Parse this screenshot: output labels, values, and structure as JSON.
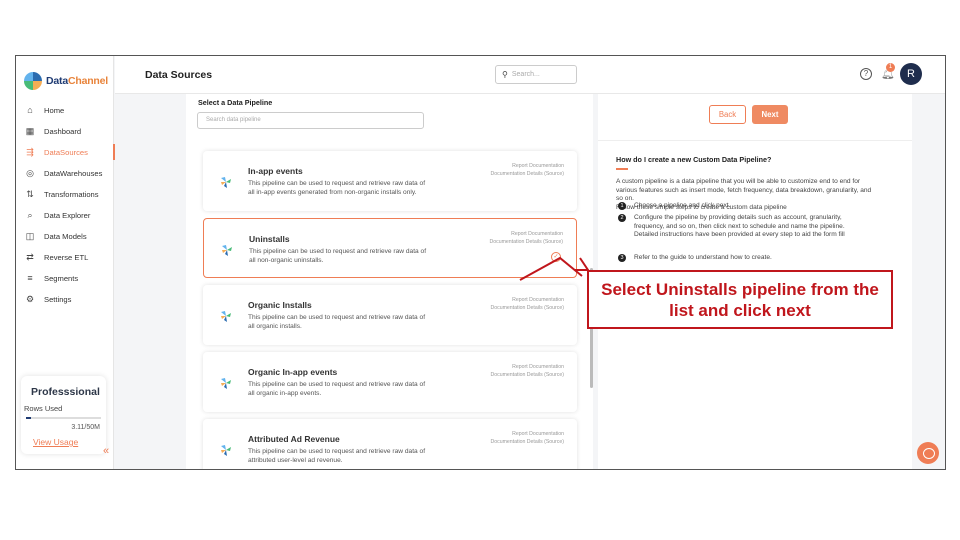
{
  "brand": {
    "part1": "Data",
    "part2": "Channel"
  },
  "sidebar": {
    "items": [
      {
        "label": "Home",
        "icon": "home-icon",
        "glyph": "⌂"
      },
      {
        "label": "Dashboard",
        "icon": "dashboard-icon",
        "glyph": "▦"
      },
      {
        "label": "DataSources",
        "icon": "datasources-icon",
        "glyph": "⇶"
      },
      {
        "label": "DataWarehouses",
        "icon": "warehouse-icon",
        "glyph": "◎"
      },
      {
        "label": "Transformations",
        "icon": "transform-icon",
        "glyph": "⇅"
      },
      {
        "label": "Data Explorer",
        "icon": "explorer-icon",
        "glyph": "⌕"
      },
      {
        "label": "Data Models",
        "icon": "models-icon",
        "glyph": "◫"
      },
      {
        "label": "Reverse ETL",
        "icon": "reverse-etl-icon",
        "glyph": "⇄"
      },
      {
        "label": "Segments",
        "icon": "segments-icon",
        "glyph": "≡"
      },
      {
        "label": "Settings",
        "icon": "settings-icon",
        "glyph": "⚙"
      }
    ],
    "active_index": 2
  },
  "plan": {
    "name": "Professsional",
    "rows_label": "Rows Used",
    "rows_count": "3.11/50M",
    "rows_fraction": 0.062,
    "view_usage": "View Usage"
  },
  "header": {
    "title": "Data Sources",
    "search_placeholder": "Search...",
    "help": "?",
    "notif_count": "1",
    "avatar": "R"
  },
  "picker": {
    "label": "Select a Data Pipeline",
    "search_placeholder": "Search data pipeline"
  },
  "pipelines": [
    {
      "title": "In-app events",
      "desc": "This pipeline can be used to request and retrieve raw data of all in-app events generated from non-organic installs only.",
      "doc1": "Report Documentation",
      "doc2": "Documentation Details (Source)",
      "selected": false
    },
    {
      "title": "Uninstalls",
      "desc": "This pipeline can be used to request and retrieve raw data of all non-organic uninstalls.",
      "doc1": "Report Documentation",
      "doc2": "Documentation Details (Source)",
      "selected": true
    },
    {
      "title": "Organic Installs",
      "desc": "This pipeline can be used to request and retrieve raw data of all organic installs.",
      "doc1": "Report Documentation",
      "doc2": "Documentation Details (Source)",
      "selected": false
    },
    {
      "title": "Organic In-app events",
      "desc": "This pipeline can be used to request and retrieve raw data of all organic in-app events.",
      "doc1": "Report Documentation",
      "doc2": "Documentation Details (Source)",
      "selected": false
    },
    {
      "title": "Attributed Ad Revenue",
      "desc": "This pipeline can be used to request and retrieve raw data of attributed user-level ad revenue.",
      "doc1": "Report Documentation",
      "doc2": "Documentation Details (Source)",
      "selected": false
    }
  ],
  "actions": {
    "back": "Back",
    "next": "Next"
  },
  "help": {
    "question": "How do I create a new Custom Data Pipeline?",
    "paragraph": "A custom pipeline is a data pipeline that you will be able to customize end to end for various features such as insert mode, fetch frequency, data breakdown, granularity, and so on.\nFollow these simple steps to create a custom data pipeline",
    "steps": [
      {
        "n": "1",
        "text": "Choose a pipeline and click next."
      },
      {
        "n": "2",
        "text": "Configure the pipeline by providing details such as account, granularity, frequency, and so on, then click next to schedule and name the pipeline. Detailed instructions have been provided at every step to aid the form fill"
      },
      {
        "n": "3",
        "text": "Refer to the guide to understand how to create."
      }
    ]
  },
  "annotation": {
    "text": "Select Uninstalls pipeline from the list and click next",
    "color": "#c0161c"
  },
  "colors": {
    "accent": "#ef7d55",
    "brand_dark": "#1f3b73"
  }
}
